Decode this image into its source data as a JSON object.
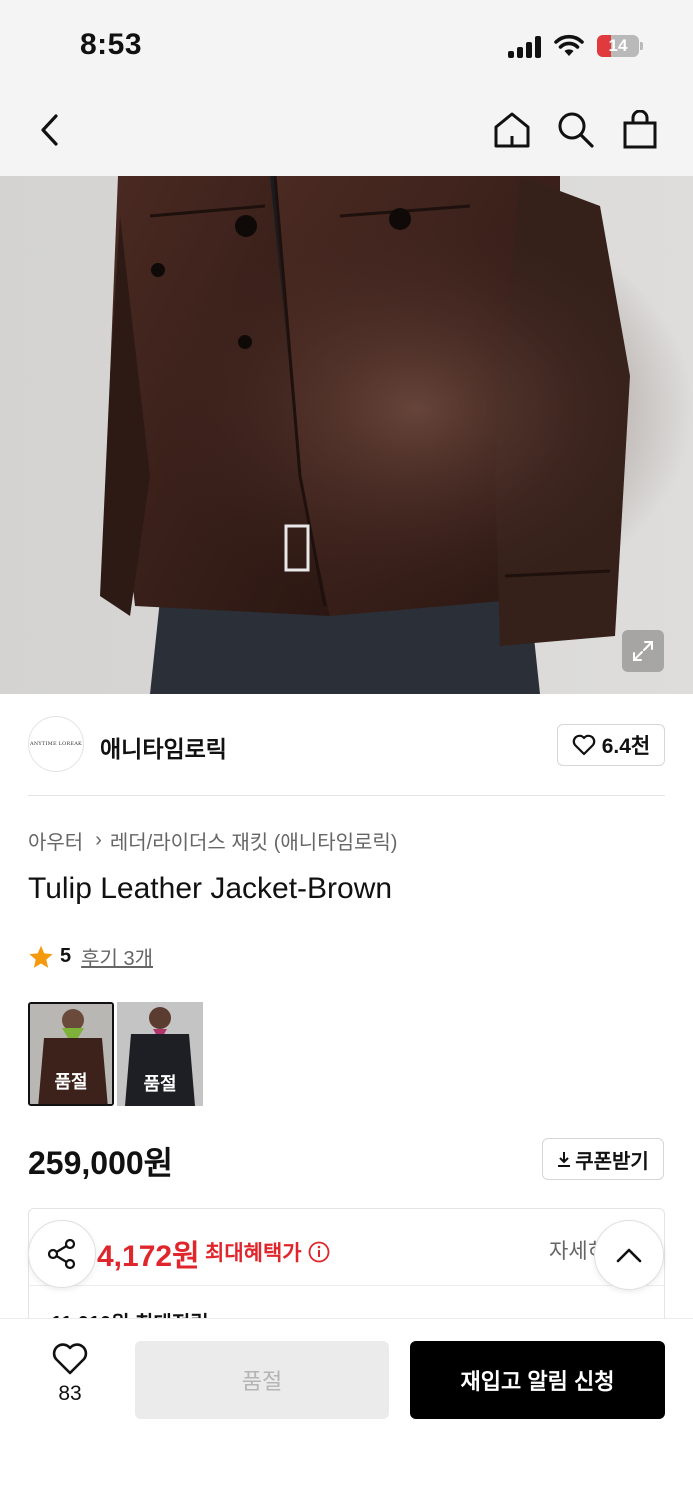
{
  "status_bar": {
    "time": "8:53",
    "battery_level": "14",
    "battery_color": "#e0393e"
  },
  "nav": {
    "back_icon": "chevron-left-icon",
    "home_icon": "home-icon",
    "search_icon": "search-icon",
    "bag_icon": "shopping-bag-icon"
  },
  "hero": {
    "expand_icon": "expand-icon"
  },
  "brand": {
    "logo_text": "ANYTIME LOREAK",
    "name": "애니타임로릭",
    "like_count": "6.4천"
  },
  "breadcrumb": {
    "category": "아우터",
    "subcategory": "레더/라이더스 재킷 (애니타임로릭)"
  },
  "product": {
    "title": "Tulip Leather Jacket-Brown",
    "rating": "5",
    "reviews": "후기 3개",
    "options": [
      {
        "label": "품절"
      },
      {
        "label": "품절"
      }
    ],
    "price": "259,000원"
  },
  "coupon": {
    "label": "쿠폰받기"
  },
  "benefit": {
    "max_price": "4,172원",
    "max_label": "최대혜택가",
    "detail": "자세히",
    "points": "11,010원 최대적립"
  },
  "bottom_bar": {
    "wish_count": "83",
    "soldout_label": "품절",
    "restock_label": "재입고 알림 신청"
  },
  "colors": {
    "accent_red": "#e0262d",
    "primary_black": "#000000"
  }
}
